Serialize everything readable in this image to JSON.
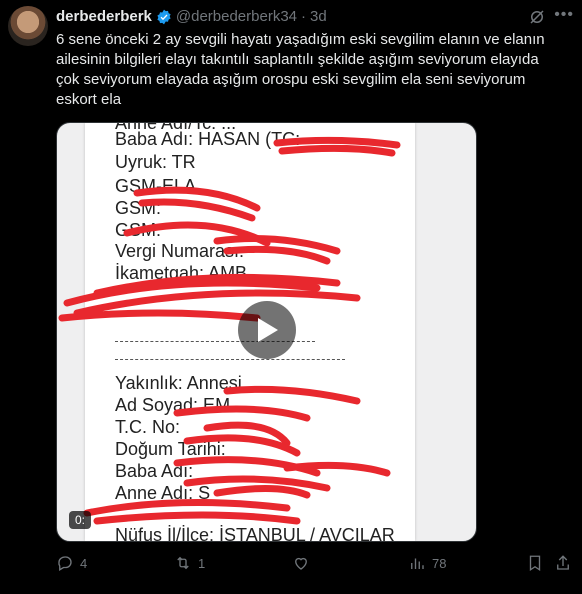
{
  "user": {
    "name": "derbederberk",
    "handle": "@derbederberk34",
    "separator": "·",
    "time": "3d"
  },
  "tweet": {
    "text": "6 sene önceki 2 ay sevgili hayatı yaşadığım eski sevgilim elanın ve elanın ailesinin bilgileri elayı takıntılı saplantılı şekilde aşığım seviyorum elayıda çok seviyorum elayada aşığım orospu eski sevgilim ela seni seviyorum eskort ela"
  },
  "media": {
    "lines": [
      "Anne Adı/Tc: ...",
      "Baba Adı: HASAN (TC:",
      "Uyruk: TR",
      "GSM-ELA",
      "GSM:",
      "GSM:",
      "Vergi Numarası:",
      "İkametgah: AMB",
      "Yakınlık: Annesi",
      "Ad Soyad: EM",
      "T.C. No:",
      "Doğum Tarihi:",
      "Baba Adı:",
      "Anne Adı: S",
      "Nüfus İl/İlçe: İSTANBUL / AVCILAR"
    ],
    "time_badge": "0:",
    "colors": {
      "redaction": "#e8282e"
    }
  },
  "actions": {
    "replies": "4",
    "reposts": "1",
    "likes": "",
    "views": "78"
  },
  "icons": [
    "verified-icon",
    "grok-icon",
    "more-icon",
    "play-icon",
    "reply-icon",
    "repost-icon",
    "like-icon",
    "views-icon",
    "bookmark-icon",
    "share-icon"
  ]
}
